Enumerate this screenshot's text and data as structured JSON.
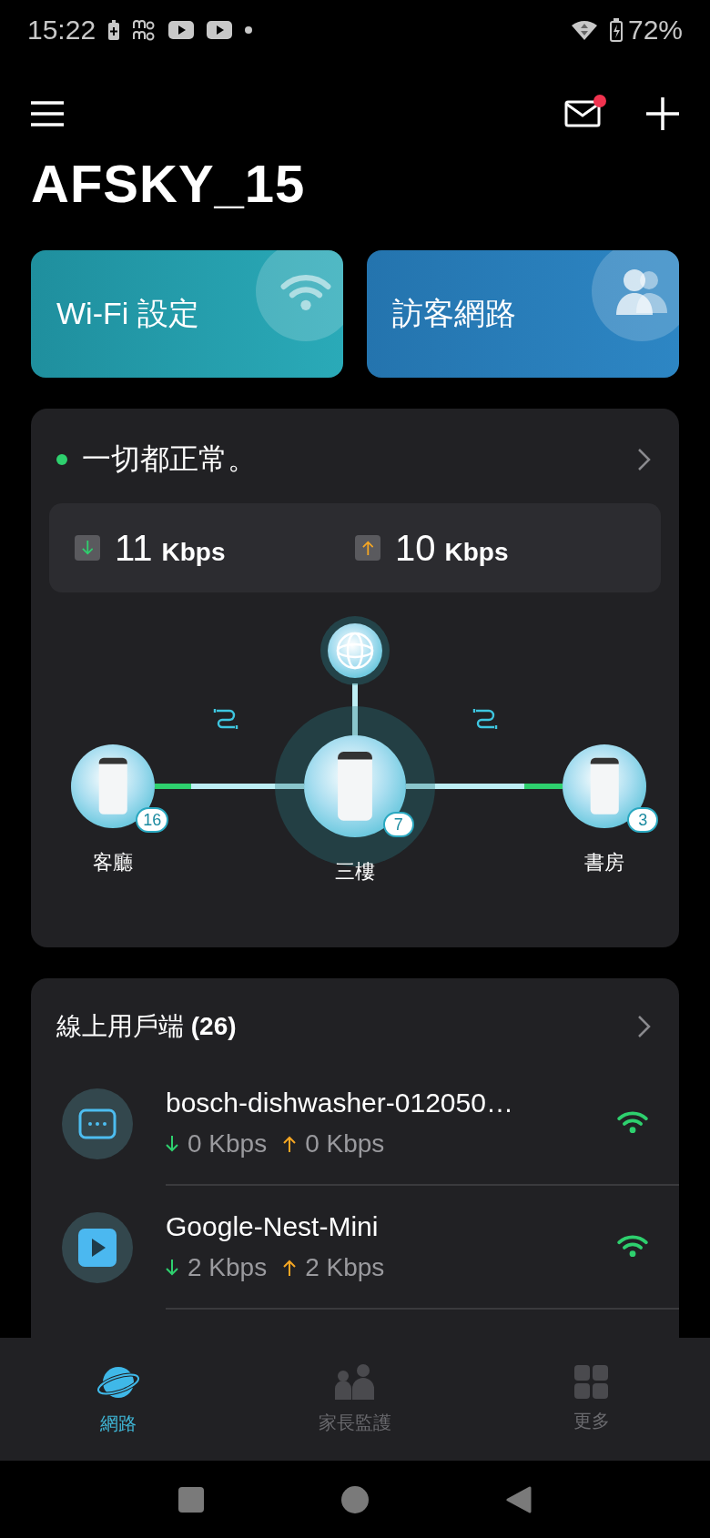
{
  "status_bar": {
    "time": "15:22",
    "battery": "72%"
  },
  "header": {
    "title": "AFSKY_15",
    "mail_unread": true
  },
  "quick_actions": [
    {
      "label": "Wi-Fi 設定",
      "kind": "wifi"
    },
    {
      "label": "訪客網路",
      "kind": "guest"
    }
  ],
  "network_status": {
    "message": "一切都正常。",
    "download": {
      "value": "11",
      "unit": "Kbps"
    },
    "upload": {
      "value": "10",
      "unit": "Kbps"
    },
    "nodes": [
      {
        "name": "客廳",
        "clients": "16"
      },
      {
        "name": "三樓",
        "clients": "7"
      },
      {
        "name": "書房",
        "clients": "3"
      }
    ]
  },
  "clients": {
    "title": "線上用戶端 **(26)**",
    "items": [
      {
        "name": "bosch-dishwasher-012050…",
        "download": "0 Kbps",
        "upload": "0 Kbps",
        "kind": "appliance"
      },
      {
        "name": "Google-Nest-Mini",
        "download": "2 Kbps",
        "upload": "2 Kbps",
        "kind": "media"
      }
    ]
  },
  "bottom_nav": [
    {
      "label": "網路",
      "selected": true,
      "kind": "network"
    },
    {
      "label": "家長監護",
      "selected": false,
      "kind": "family"
    },
    {
      "label": "更多",
      "selected": false,
      "kind": "more"
    }
  ]
}
